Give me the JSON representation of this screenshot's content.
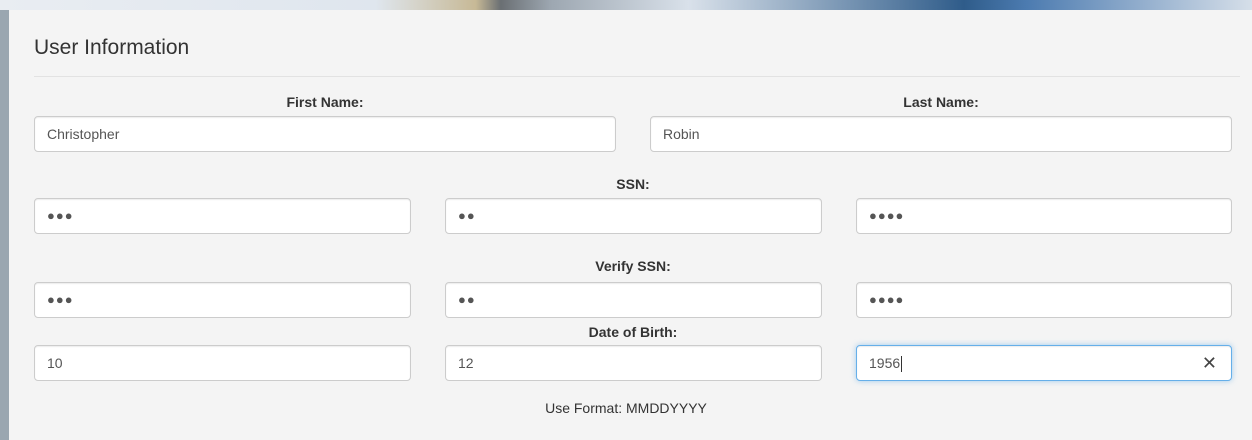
{
  "section": {
    "title": "User Information"
  },
  "first_name": {
    "label": "First Name:",
    "value": "Christopher"
  },
  "last_name": {
    "label": "Last Name:",
    "value": "Robin"
  },
  "ssn": {
    "label": "SSN:",
    "part1": "●●●",
    "part2": "●●",
    "part3": "●●●●"
  },
  "verify_ssn": {
    "label": "Verify SSN:",
    "part1": "●●●",
    "part2": "●●",
    "part3": "●●●●"
  },
  "dob": {
    "label": "Date of Birth:",
    "month": "10",
    "day": "12",
    "year": "1956",
    "clear_icon": "✕"
  },
  "hint": "Use Format: MMDDYYYY"
}
